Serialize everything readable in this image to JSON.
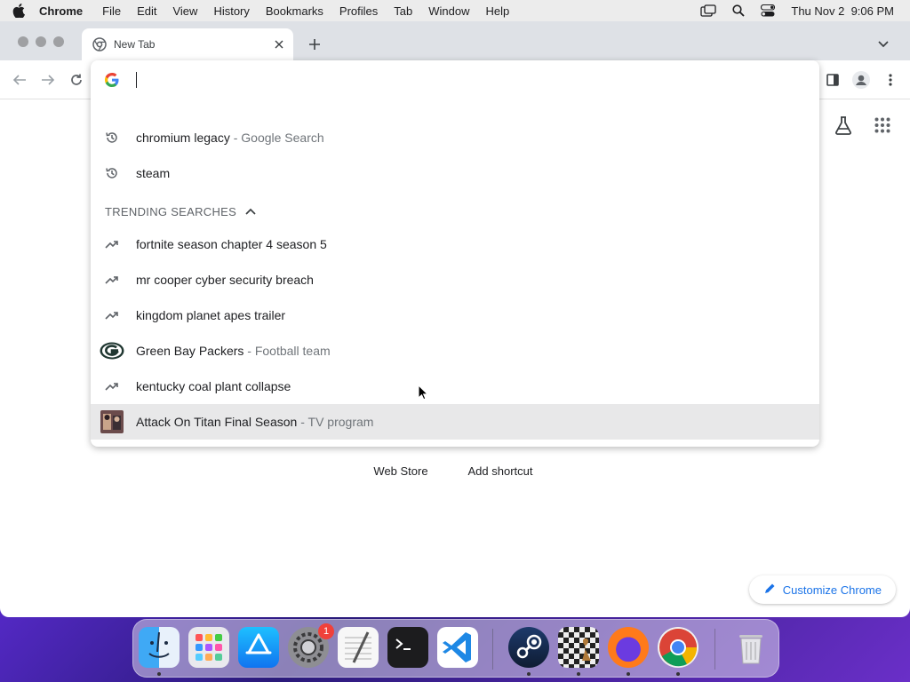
{
  "menubar": {
    "app": "Chrome",
    "items": [
      "File",
      "Edit",
      "View",
      "History",
      "Bookmarks",
      "Profiles",
      "Tab",
      "Window",
      "Help"
    ],
    "datetime": "Thu Nov 2  9:06 PM"
  },
  "tab": {
    "title": "New Tab"
  },
  "omnibox": {
    "value": "",
    "recent": [
      {
        "text": "chromium legacy",
        "desc": " - Google Search",
        "icon": "history-icon"
      },
      {
        "text": "steam",
        "desc": "",
        "icon": "history-icon"
      }
    ],
    "trending_header": "TRENDING SEARCHES",
    "trending": [
      {
        "text": "fortnite season chapter 4 season 5",
        "desc": "",
        "icon": "trending-icon"
      },
      {
        "text": "mr cooper cyber security breach",
        "desc": "",
        "icon": "trending-icon"
      },
      {
        "text": "kingdom planet apes trailer",
        "desc": "",
        "icon": "trending-icon"
      },
      {
        "text": "Green Bay Packers",
        "desc": " - Football team",
        "icon": "packers-logo-icon"
      },
      {
        "text": "kentucky coal plant collapse",
        "desc": "",
        "icon": "trending-icon"
      },
      {
        "text": "Attack On Titan Final Season",
        "desc": " - TV program",
        "icon": "tv-thumbnail-icon"
      }
    ]
  },
  "ntp": {
    "shortcuts": [
      {
        "label": "Web Store"
      },
      {
        "label": "Add shortcut"
      }
    ],
    "customize_label": "Customize Chrome"
  },
  "dock": {
    "apps": [
      "Finder",
      "Launchpad",
      "App Store",
      "System Settings",
      "TextEdit",
      "Terminal",
      "Visual Studio Code",
      "Steam",
      "Chess",
      "Firefox",
      "Google Chrome",
      "Trash"
    ],
    "settings_badge": "1"
  },
  "colors": {
    "accent": "#1a73e8",
    "highlight_row": "#e8e8e9"
  }
}
